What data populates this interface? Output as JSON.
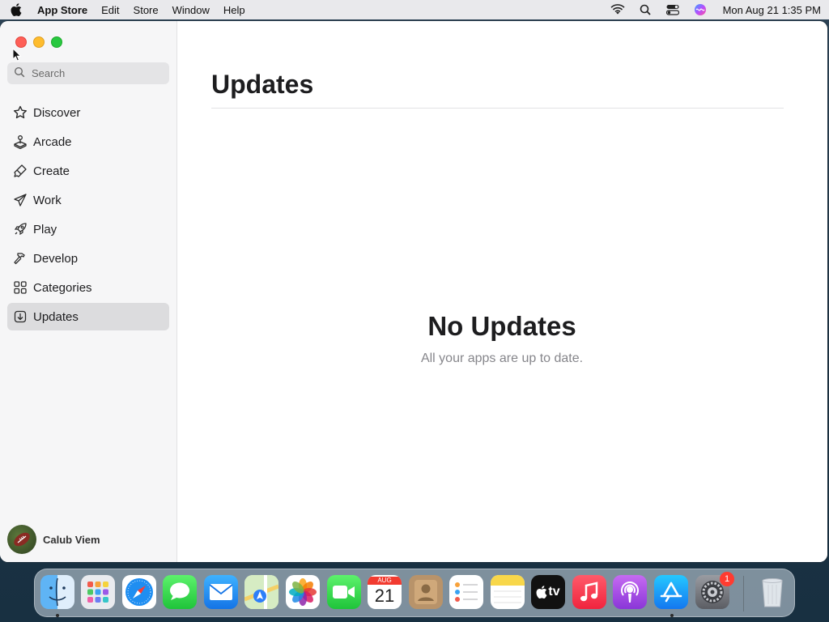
{
  "menubar": {
    "app_name": "App Store",
    "items": [
      "Edit",
      "Store",
      "Window",
      "Help"
    ],
    "datetime": "Mon Aug 21  1:35 PM"
  },
  "sidebar": {
    "search_placeholder": "Search",
    "items": [
      {
        "label": "Discover",
        "icon": "star-icon"
      },
      {
        "label": "Arcade",
        "icon": "joystick-icon"
      },
      {
        "label": "Create",
        "icon": "paintbrush-icon"
      },
      {
        "label": "Work",
        "icon": "paperplane-icon"
      },
      {
        "label": "Play",
        "icon": "rocket-icon"
      },
      {
        "label": "Develop",
        "icon": "hammer-icon"
      },
      {
        "label": "Categories",
        "icon": "grid-icon"
      },
      {
        "label": "Updates",
        "icon": "download-icon",
        "active": true
      }
    ],
    "user_name": "Calub Viem"
  },
  "main": {
    "title": "Updates",
    "empty_title": "No Updates",
    "empty_subtitle": "All your apps are up to date."
  },
  "dock": {
    "calendar_month": "AUG",
    "calendar_day": "21",
    "tv_label": "tv",
    "settings_badge": "1",
    "apps": [
      "finder",
      "launchpad",
      "safari",
      "messages",
      "mail",
      "maps",
      "photos",
      "facetime",
      "calendar",
      "contacts",
      "reminders",
      "notes",
      "apple-tv",
      "music",
      "podcasts",
      "app-store",
      "system-settings",
      "trash"
    ]
  },
  "colors": {
    "accent": "#0a84ff",
    "selection": "#dcdcde",
    "sidebar_bg": "#f6f6f7"
  }
}
